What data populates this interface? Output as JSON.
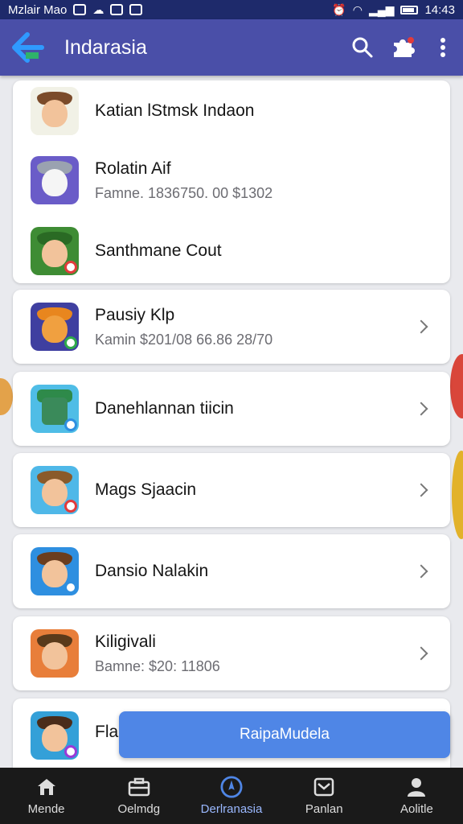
{
  "status_bar": {
    "carrier": "Mzlair Mao",
    "time": "14:43",
    "colors": {
      "background": "#1e2a6b"
    }
  },
  "app_bar": {
    "title": "Indarasia",
    "icons": [
      "back-arrow-icon",
      "search-icon",
      "puzzle-icon",
      "more-vert-icon"
    ],
    "colors": {
      "background": "#4a4fa8",
      "back_arrow": "#2f9aff"
    }
  },
  "grouped_card": {
    "items": [
      {
        "title": "Katian lStmsk Indaon",
        "subtitle": "",
        "avatar_colors": [
          "#f1f1e6",
          "#7b4b2a"
        ]
      },
      {
        "title": "Rolatin Aif",
        "subtitle": "Famne. 1836750. 00 $1302",
        "avatar_colors": [
          "#6a5cc8",
          "#9aa2b0"
        ]
      },
      {
        "title": "Santhmane Cout",
        "subtitle": "",
        "avatar_colors": [
          "#3e8c34",
          "#2a6a24"
        ]
      }
    ]
  },
  "list": {
    "items": [
      {
        "title": "Pausiy Klp",
        "subtitle": "Kamin  $201/08 66.86 28/70",
        "avatar_colors": [
          "#3f3fa0",
          "#e8861e"
        ]
      },
      {
        "title": "Danehlannan tiicin",
        "subtitle": "",
        "avatar_colors": [
          "#4fbde6",
          "#2e8a4a"
        ]
      },
      {
        "title": "Mags Sjaacin",
        "subtitle": "",
        "avatar_colors": [
          "#4fb8e8",
          "#8a5a2a"
        ]
      },
      {
        "title": "Dansio Nalakin",
        "subtitle": "",
        "avatar_colors": [
          "#2e8fe0",
          "#6b3d1e"
        ]
      },
      {
        "title": "Kiligivali",
        "subtitle": "Bamne: $20: 11806",
        "avatar_colors": [
          "#e87e3a",
          "#5a3a1a"
        ]
      },
      {
        "title": "Fla",
        "subtitle": "",
        "avatar_colors": [
          "#34a0d8",
          "#4a2c1a"
        ]
      }
    ]
  },
  "fab": {
    "label": "RaipaMudela",
    "color": "#4f86e6"
  },
  "bottom_nav": {
    "items": [
      {
        "label": "Mende",
        "icon": "home-icon"
      },
      {
        "label": "Oelmdg",
        "icon": "briefcase-icon"
      },
      {
        "label": "Derlranasia",
        "icon": "compass-icon",
        "active": true
      },
      {
        "label": "Panlan",
        "icon": "inbox-icon"
      },
      {
        "label": "Aolitle",
        "icon": "profile-icon"
      }
    ]
  }
}
